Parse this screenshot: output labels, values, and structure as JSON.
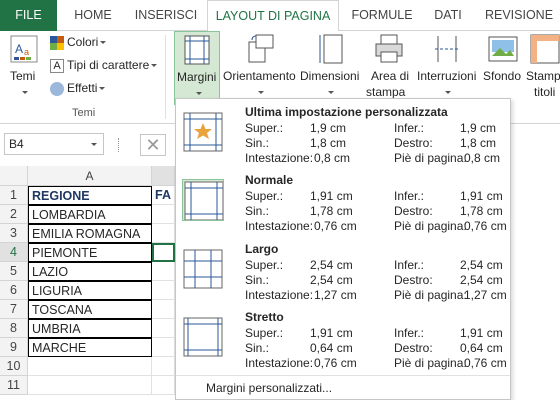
{
  "tabs": [
    {
      "label": "FILE"
    },
    {
      "label": "HOME"
    },
    {
      "label": "INSERISCI"
    },
    {
      "label": "LAYOUT DI PAGINA"
    },
    {
      "label": "FORMULE"
    },
    {
      "label": "DATI"
    },
    {
      "label": "REVISIONE"
    }
  ],
  "ribbon": {
    "temi": "Temi",
    "colori": "Colori",
    "tipi": "Tipi di carattere",
    "effetti": "Effetti",
    "group_temi": "Temi",
    "margini": "Margini",
    "orientamento": "Orientamento",
    "dimensioni": "Dimensioni",
    "area_line1": "Area di",
    "area_line2": "stampa",
    "interruzioni": "Interruzioni",
    "sfondo": "Sfondo",
    "stampa_line1": "Stamp",
    "stampa_line2": "titoli"
  },
  "namebox": "B4",
  "grid": {
    "col_a": "A",
    "rows": [
      "1",
      "2",
      "3",
      "4",
      "5",
      "6",
      "7",
      "8",
      "9",
      "10",
      "11"
    ],
    "cells": [
      "REGIONE",
      "LOMBARDIA",
      "EMILIA ROMAGNA",
      "PIEMONTE",
      "LAZIO",
      "LIGURIA",
      "TOSCANA",
      "UMBRIA",
      "MARCHE",
      "",
      ""
    ],
    "b1": "FA"
  },
  "margins": {
    "options": [
      {
        "title": "Ultima impostazione personalizzata",
        "super": "1,9 cm",
        "infer": "1,9 cm",
        "sin": "1,8 cm",
        "destro": "1,8 cm",
        "intest": "0,8 cm",
        "pie": "0,8 cm"
      },
      {
        "title": "Normale",
        "super": "1,91 cm",
        "infer": "1,91 cm",
        "sin": "1,78 cm",
        "destro": "1,78 cm",
        "intest": "0,76 cm",
        "pie": "0,76 cm"
      },
      {
        "title": "Largo",
        "super": "2,54 cm",
        "infer": "2,54 cm",
        "sin": "2,54 cm",
        "destro": "2,54 cm",
        "intest": "1,27 cm",
        "pie": "1,27 cm"
      },
      {
        "title": "Stretto",
        "super": "1,91 cm",
        "infer": "1,91 cm",
        "sin": "0,64 cm",
        "destro": "0,64 cm",
        "intest": "0,76 cm",
        "pie": "0,76 cm"
      }
    ],
    "labels": {
      "super": "Super.:",
      "infer": "Infer.:",
      "sin": "Sin.:",
      "destro": "Destro:",
      "intest": "Intestazione:",
      "pie": "Piè di pagina:"
    },
    "custom": "Margini personalizzati..."
  },
  "colors": {
    "accent": "#217346",
    "selected_bg": "#d5e8d4"
  }
}
